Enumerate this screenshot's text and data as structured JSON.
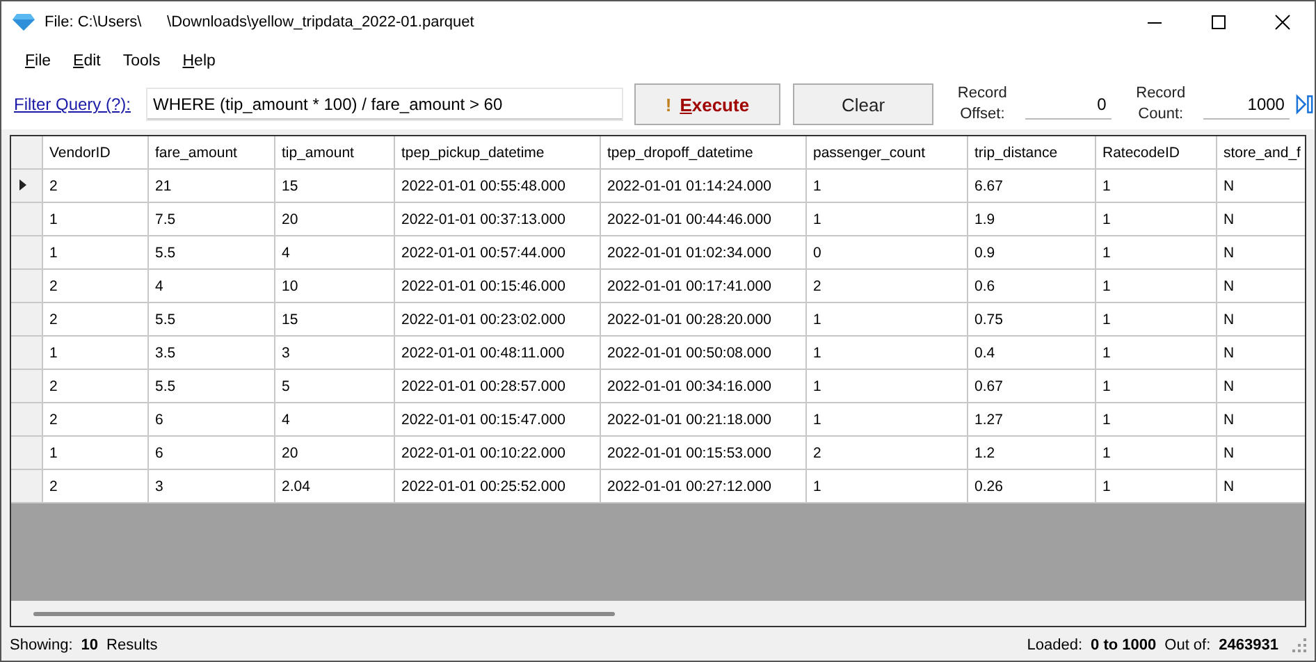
{
  "window": {
    "title": "File: C:\\Users\\      \\Downloads\\yellow_tripdata_2022-01.parquet"
  },
  "menu": [
    {
      "access_key": "F",
      "label_rest": "ile"
    },
    {
      "access_key": "E",
      "label_rest": "dit"
    },
    {
      "label_rest": "Tools"
    },
    {
      "access_key": "H",
      "label_rest": "elp"
    }
  ],
  "toolbar": {
    "filter_link": "Filter Query (?):",
    "query": "WHERE (tip_amount * 100) / fare_amount > 60",
    "execute": {
      "icon": "!",
      "access_key": "E",
      "label_rest": "xecute"
    },
    "clear": "Clear",
    "offset_label": "Record Offset:",
    "offset_value": "0",
    "count_label": "Record Count:",
    "count_value": "1000"
  },
  "table": {
    "columns": [
      "VendorID",
      "fare_amount",
      "tip_amount",
      "tpep_pickup_datetime",
      "tpep_dropoff_datetime",
      "passenger_count",
      "trip_distance",
      "RatecodeID",
      "store_and_f"
    ],
    "rows": [
      {
        "selected": true,
        "cells": [
          "2",
          "21",
          "15",
          "2022-01-01 00:55:48.000",
          "2022-01-01 01:14:24.000",
          "1",
          "6.67",
          "1",
          "N"
        ]
      },
      {
        "selected": false,
        "cells": [
          "1",
          "7.5",
          "20",
          "2022-01-01 00:37:13.000",
          "2022-01-01 00:44:46.000",
          "1",
          "1.9",
          "1",
          "N"
        ]
      },
      {
        "selected": false,
        "cells": [
          "1",
          "5.5",
          "4",
          "2022-01-01 00:57:44.000",
          "2022-01-01 01:02:34.000",
          "0",
          "0.9",
          "1",
          "N"
        ]
      },
      {
        "selected": false,
        "cells": [
          "2",
          "4",
          "10",
          "2022-01-01 00:15:46.000",
          "2022-01-01 00:17:41.000",
          "2",
          "0.6",
          "1",
          "N"
        ]
      },
      {
        "selected": false,
        "cells": [
          "2",
          "5.5",
          "15",
          "2022-01-01 00:23:02.000",
          "2022-01-01 00:28:20.000",
          "1",
          "0.75",
          "1",
          "N"
        ]
      },
      {
        "selected": false,
        "cells": [
          "1",
          "3.5",
          "3",
          "2022-01-01 00:48:11.000",
          "2022-01-01 00:50:08.000",
          "1",
          "0.4",
          "1",
          "N"
        ]
      },
      {
        "selected": false,
        "cells": [
          "2",
          "5.5",
          "5",
          "2022-01-01 00:28:57.000",
          "2022-01-01 00:34:16.000",
          "1",
          "0.67",
          "1",
          "N"
        ]
      },
      {
        "selected": false,
        "cells": [
          "2",
          "6",
          "4",
          "2022-01-01 00:15:47.000",
          "2022-01-01 00:21:18.000",
          "1",
          "1.27",
          "1",
          "N"
        ]
      },
      {
        "selected": false,
        "cells": [
          "1",
          "6",
          "20",
          "2022-01-01 00:10:22.000",
          "2022-01-01 00:15:53.000",
          "2",
          "1.2",
          "1",
          "N"
        ]
      },
      {
        "selected": false,
        "cells": [
          "2",
          "3",
          "2.04",
          "2022-01-01 00:25:52.000",
          "2022-01-01 00:27:12.000",
          "1",
          "0.26",
          "1",
          "N"
        ]
      }
    ]
  },
  "status_bar": {
    "showing_label": "Showing:",
    "showing_count": "10",
    "showing_suffix": "Results",
    "loaded_label": "Loaded:",
    "loaded_range": "0 to 1000",
    "out_of_label": "Out of:",
    "total": "2463931"
  }
}
